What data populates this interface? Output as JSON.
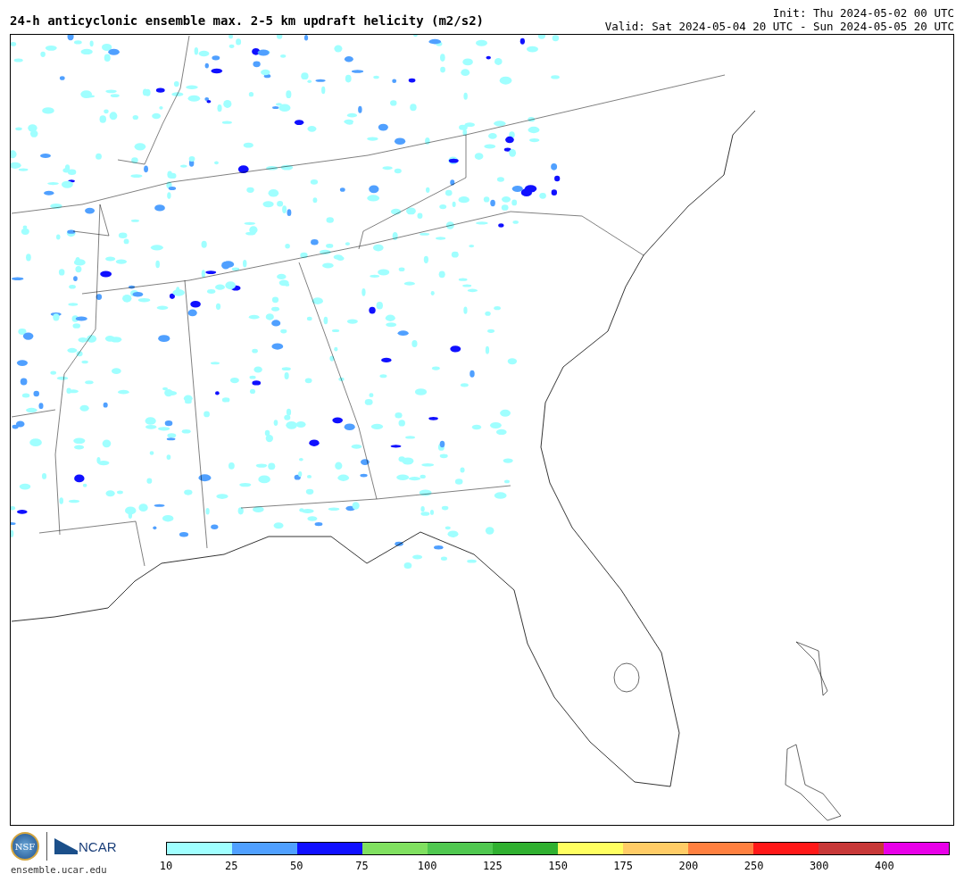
{
  "title": "24-h anticyclonic ensemble max. 2-5 km updraft helicity (m2/s2)",
  "init": "Init: Thu 2024-05-02 00 UTC",
  "valid": "Valid: Sat 2024-05-04 20 UTC - Sun 2024-05-05 20 UTC",
  "logos": {
    "nsf": "NSF",
    "ncar": "NCAR",
    "website": "ensemble.ucar.edu"
  },
  "colorbar": [
    {
      "label": "10",
      "color": "#a0ffff"
    },
    {
      "label": "25",
      "color": "#50a0ff"
    },
    {
      "label": "50",
      "color": "#1010ff"
    },
    {
      "label": "75",
      "color": "#80e060"
    },
    {
      "label": "100",
      "color": "#50c850"
    },
    {
      "label": "125",
      "color": "#30b030"
    },
    {
      "label": "150",
      "color": "#ffff60"
    },
    {
      "label": "175",
      "color": "#ffcc66"
    },
    {
      "label": "200",
      "color": "#ff8040"
    },
    {
      "label": "250",
      "color": "#ff1818"
    },
    {
      "label": "300",
      "color": "#c83838"
    },
    {
      "label": "400",
      "color": "#e800e8"
    }
  ]
}
